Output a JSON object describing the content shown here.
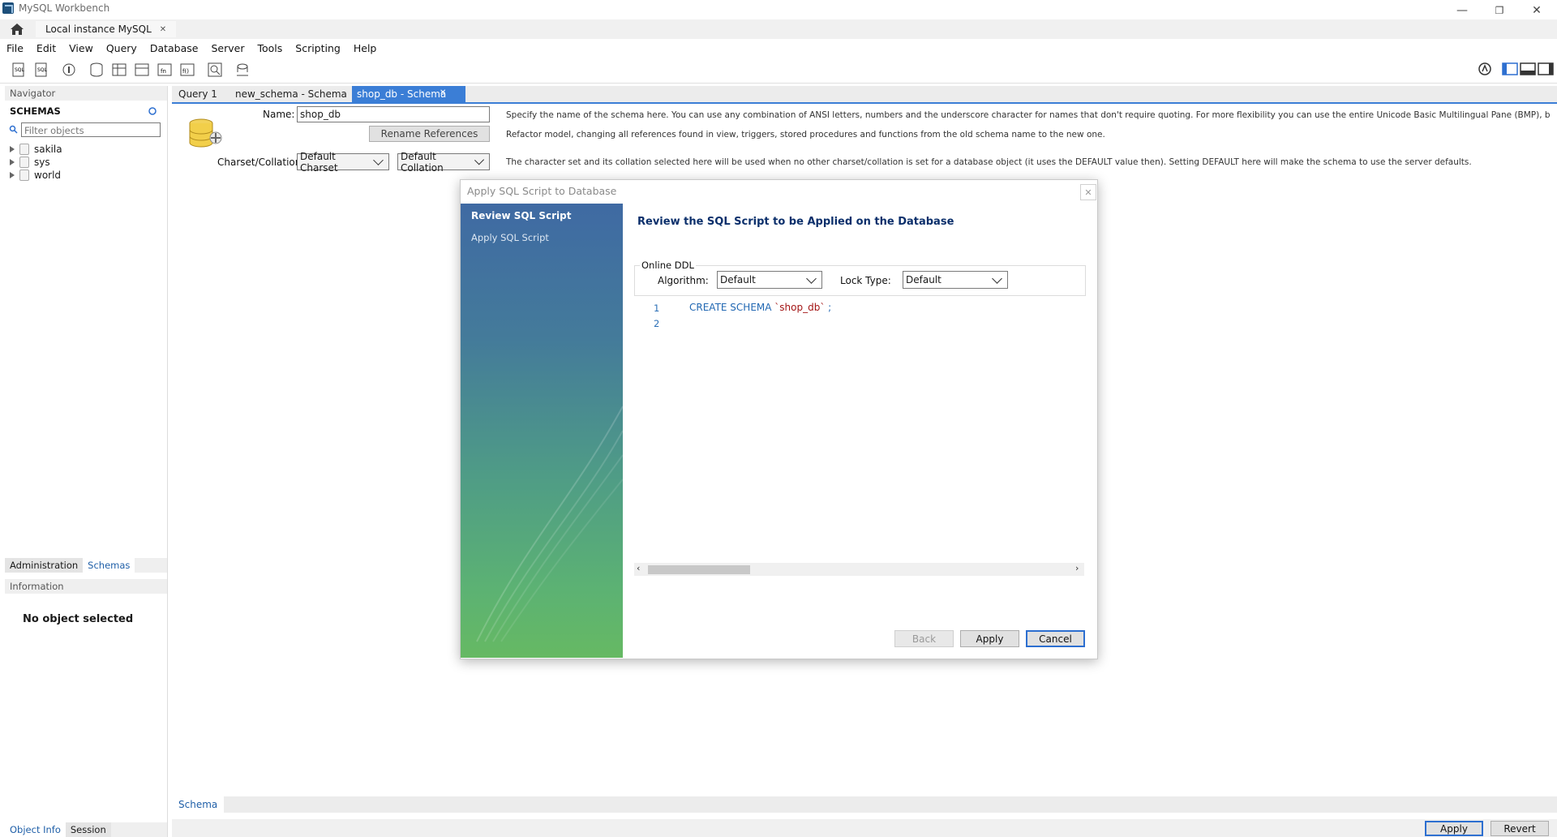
{
  "window": {
    "title": "MySQL Workbench"
  },
  "connection_tab": {
    "label": "Local instance MySQL",
    "close": "✕"
  },
  "menu": [
    "File",
    "Edit",
    "View",
    "Query",
    "Database",
    "Server",
    "Tools",
    "Scripting",
    "Help"
  ],
  "navigator": {
    "header": "Navigator",
    "section": "SCHEMAS",
    "filter_placeholder": "Filter objects",
    "schemas": [
      "sakila",
      "sys",
      "world"
    ],
    "tabs": [
      "Administration",
      "Schemas"
    ],
    "info_header": "Information",
    "no_object": "No object selected",
    "bottom_tabs": [
      "Object Info",
      "Session"
    ]
  },
  "editor_tabs": [
    {
      "label": "Query 1",
      "active": false
    },
    {
      "label": "new_schema - Schema",
      "active": false
    },
    {
      "label": "shop_db - Schema",
      "active": true
    }
  ],
  "schema_editor": {
    "name_label": "Name:",
    "name_value": "shop_db",
    "rename_button": "Rename References",
    "charset_label": "Charset/Collation:",
    "charset_value": "Default Charset",
    "collation_value": "Default Collation",
    "desc_name": "Specify the name of the schema here. You can use any combination of ANSI letters, numbers and the underscore character for names that don't require quoting. For more flexibility you can use the entire Unicode Basic Multilingual Pane (BMP), but you will have to quote the name later w",
    "desc_refactor": "Refactor model, changing all references found in view, triggers, stored procedures and functions from the old schema name to the new one.",
    "desc_charset": "The character set and its collation selected here will be used when no other charset/collation is set for a database object (it uses the DEFAULT value then). Setting DEFAULT here will make the schema to use the server defaults."
  },
  "dialog": {
    "title": "Apply SQL Script to Database",
    "steps": [
      "Review SQL Script",
      "Apply SQL Script"
    ],
    "heading": "Review the SQL Script to be Applied on the Database",
    "online_ddl": "Online DDL",
    "algorithm_label": "Algorithm:",
    "algorithm_value": "Default",
    "lock_label": "Lock Type:",
    "lock_value": "Default",
    "sql_lines": [
      "1",
      "2"
    ],
    "sql_keyword": "CREATE SCHEMA ",
    "sql_name": "`shop_db`",
    "sql_end": " ;",
    "back": "Back",
    "apply": "Apply",
    "cancel": "Cancel"
  },
  "bottom": {
    "subtab": "Schema",
    "apply": "Apply",
    "revert": "Revert"
  },
  "colors": {
    "accent": "#3b7ed6",
    "heading": "#0b2f6b"
  }
}
